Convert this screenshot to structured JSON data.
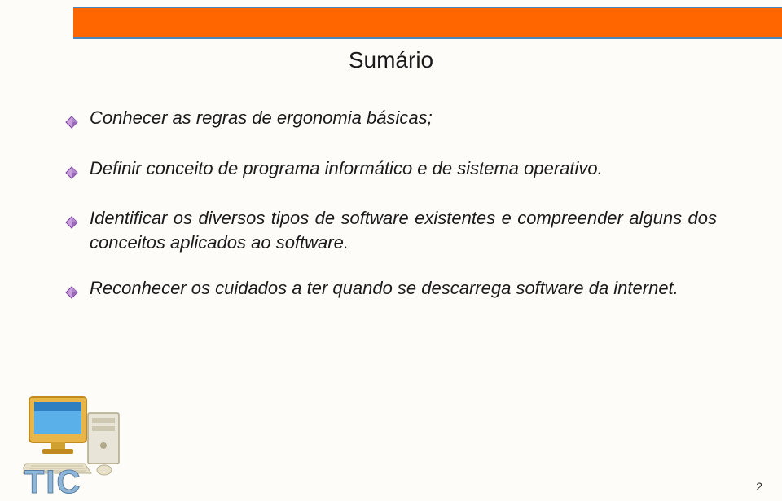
{
  "header": {
    "title": "Sumário"
  },
  "bullets": [
    {
      "text": "Conhecer as regras de ergonomia básicas;"
    },
    {
      "text": "Definir conceito de programa informático e de sistema operativo."
    },
    {
      "text": "Identificar os diversos tipos de software existentes e compreender alguns dos conceitos aplicados ao software."
    },
    {
      "text": "Reconhecer os cuidados a ter quando se descarrega software da internet."
    }
  ],
  "footer": {
    "tic": "TIC",
    "page": "2"
  },
  "icons": {
    "bullet": "diamond-bullet-icon",
    "computer": "computer-icon"
  }
}
